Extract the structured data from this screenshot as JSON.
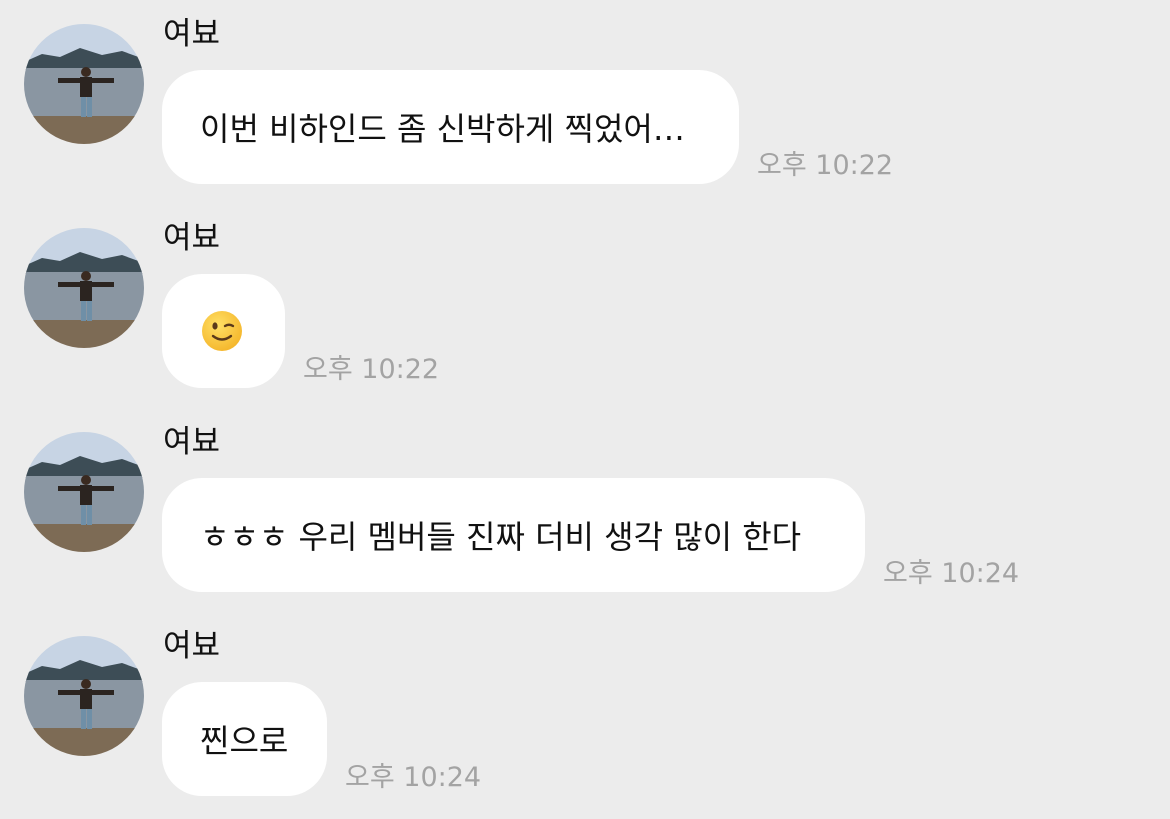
{
  "messages": [
    {
      "sender": "여뵤",
      "text": "이번 비하인드 좀 신박하게 찍었어…",
      "time": "오후 10:22"
    },
    {
      "sender": "여뵤",
      "emoji": "winking-face",
      "time": "오후 10:22"
    },
    {
      "sender": "여뵤",
      "text": "ㅎㅎㅎ 우리 멤버들 진짜 더비 생각 많이 한다",
      "time": "오후 10:24"
    },
    {
      "sender": "여뵤",
      "text": "찐으로",
      "time": "오후 10:24"
    }
  ],
  "colors": {
    "background": "#ececec",
    "bubble": "#ffffff",
    "timestamp": "#a3a3a3",
    "text": "#111111"
  }
}
